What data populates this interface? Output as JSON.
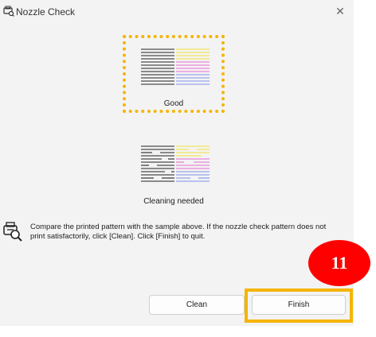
{
  "window": {
    "title": "Nozzle Check"
  },
  "samples": {
    "good_label": "Good",
    "bad_label": "Cleaning needed"
  },
  "instructions": "Compare the printed pattern with the sample above. If the nozzle check pattern does not print satisfactorily, click [Clean]. Click [Finish] to quit.",
  "buttons": {
    "clean": "Clean",
    "finish": "Finish"
  },
  "annotation": {
    "step_number": "11"
  },
  "colors": {
    "highlight": "#f5b400",
    "badge": "#ff0000"
  },
  "icons": {
    "title": "printer-nozzle-icon",
    "close": "close-icon",
    "info": "printer-info-icon"
  }
}
